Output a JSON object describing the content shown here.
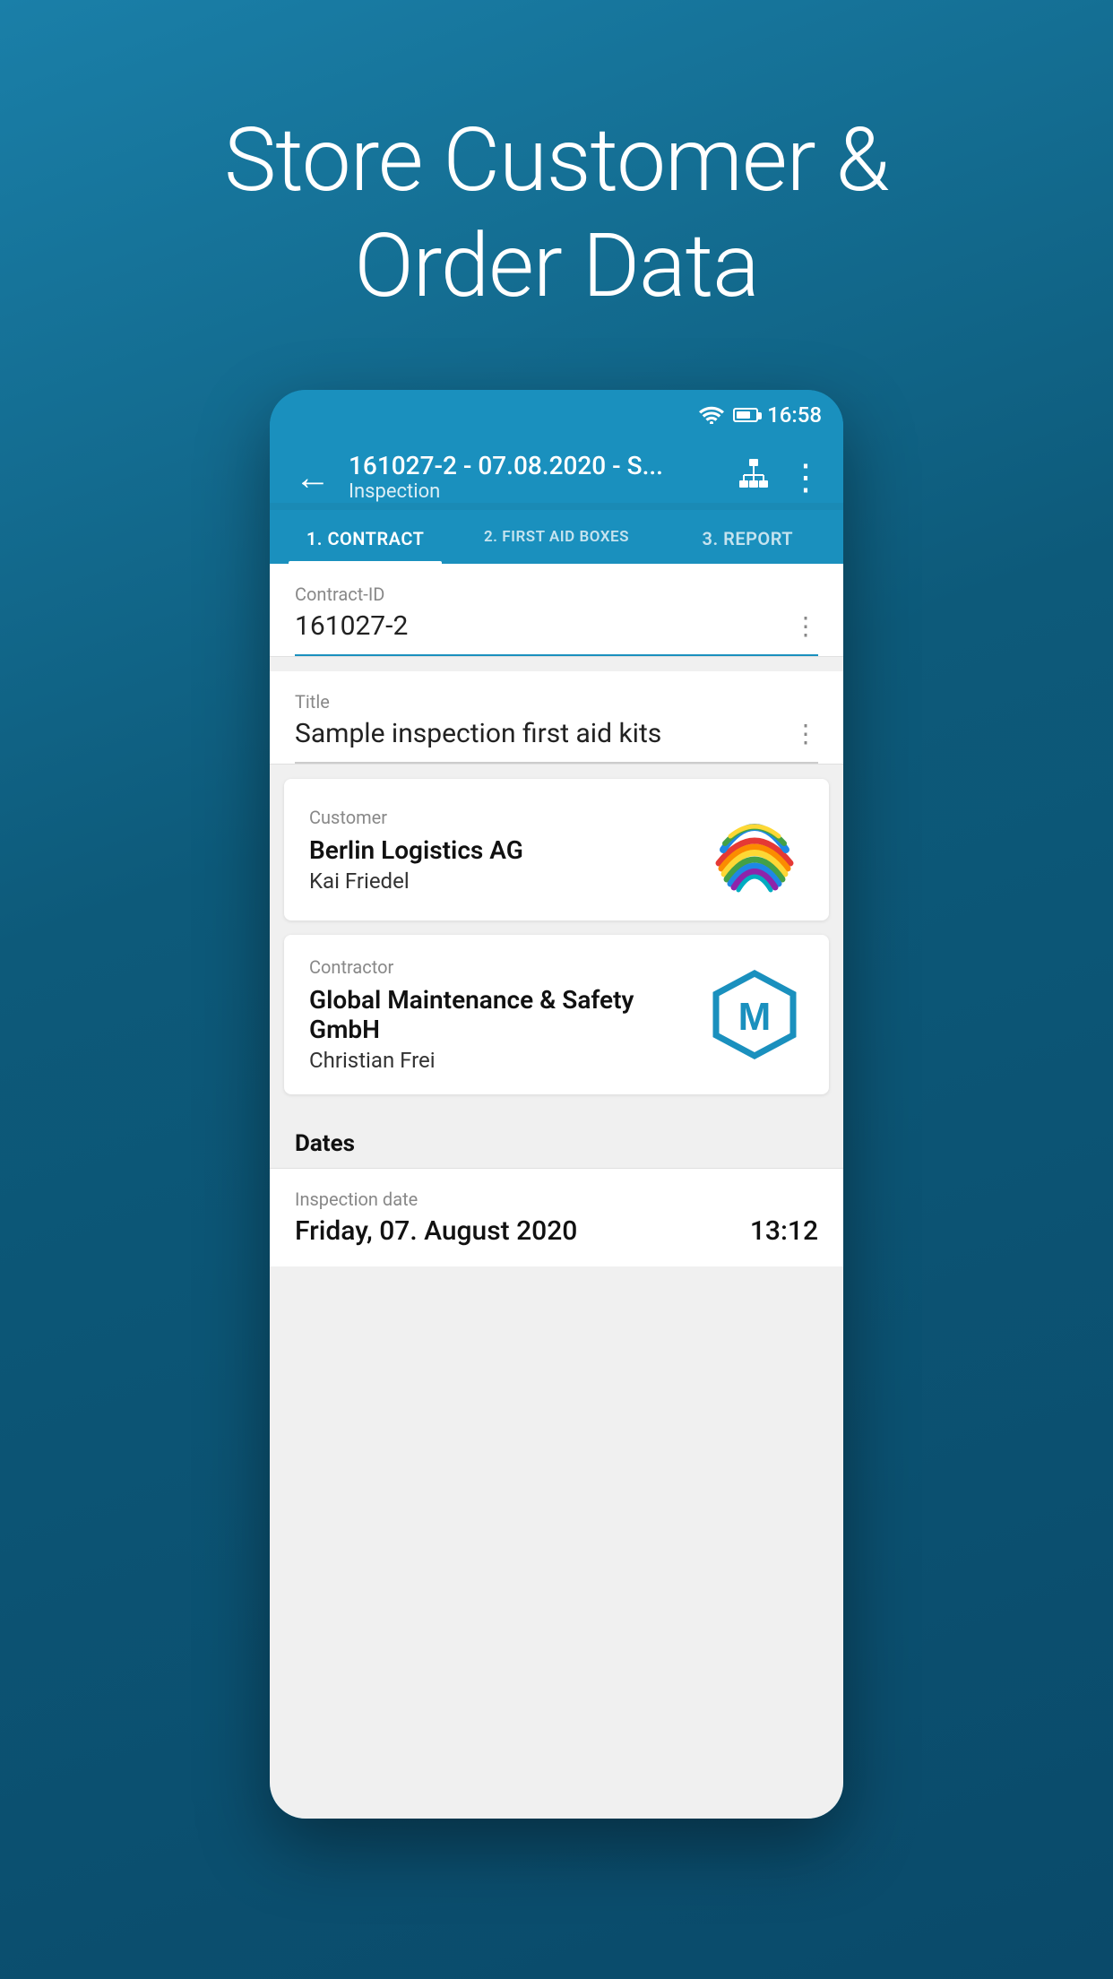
{
  "hero": {
    "title": "Store Customer &\nOrder Data"
  },
  "status_bar": {
    "time": "16:58"
  },
  "toolbar": {
    "title": "161027-2 - 07.08.2020 - S...",
    "subtitle": "Inspection",
    "back_label": "←"
  },
  "tabs": [
    {
      "id": "contract",
      "label": "1. CONTRACT",
      "active": true
    },
    {
      "id": "firstaid",
      "label": "2. FIRST AID BOXES",
      "active": false
    },
    {
      "id": "report",
      "label": "3. REPORT",
      "active": false
    }
  ],
  "contract_id_field": {
    "label": "Contract-ID",
    "value": "161027-2"
  },
  "title_field": {
    "label": "Title",
    "value": "Sample inspection first aid kits"
  },
  "customer_card": {
    "label": "Customer",
    "company": "Berlin Logistics AG",
    "person": "Kai Friedel"
  },
  "contractor_card": {
    "label": "Contractor",
    "company": "Global Maintenance & Safety GmbH",
    "person": "Christian Frei"
  },
  "dates_section": {
    "title": "Dates",
    "inspection_date_label": "Inspection date",
    "inspection_date_value": "Friday, 07. August 2020",
    "inspection_time_value": "13:12"
  },
  "more_icon": "⋮",
  "icons": {
    "back": "←",
    "hierarchy": "⊞",
    "more_vert": "⋮"
  }
}
